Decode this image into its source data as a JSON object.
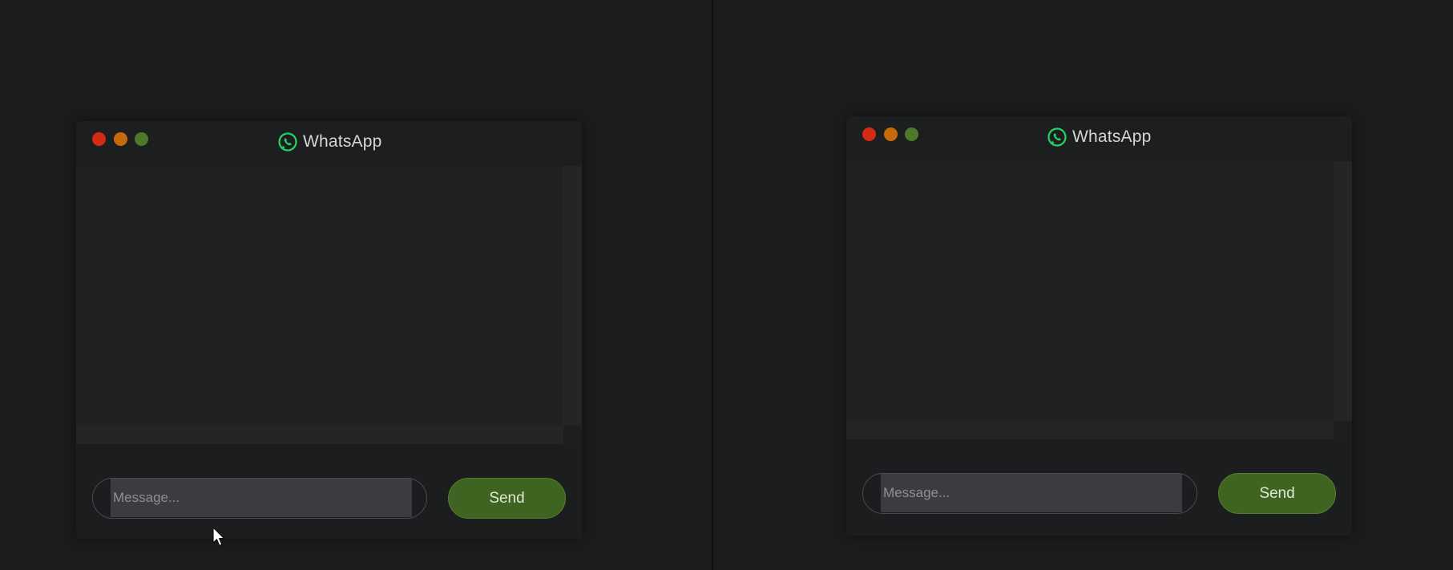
{
  "colors": {
    "close": "#d42c12",
    "minimize": "#c76a0c",
    "maximize": "#4c7a2a",
    "send_button": "#3f6321",
    "whatsapp_icon": "#25d366"
  },
  "left_window": {
    "title": "WhatsApp",
    "icon": "whatsapp-icon",
    "message_placeholder": "Message...",
    "send_label": "Send"
  },
  "right_window": {
    "title": "WhatsApp",
    "icon": "whatsapp-icon",
    "message_placeholder": "Message...",
    "send_label": "Send"
  },
  "cursor": "mouse-pointer-icon"
}
